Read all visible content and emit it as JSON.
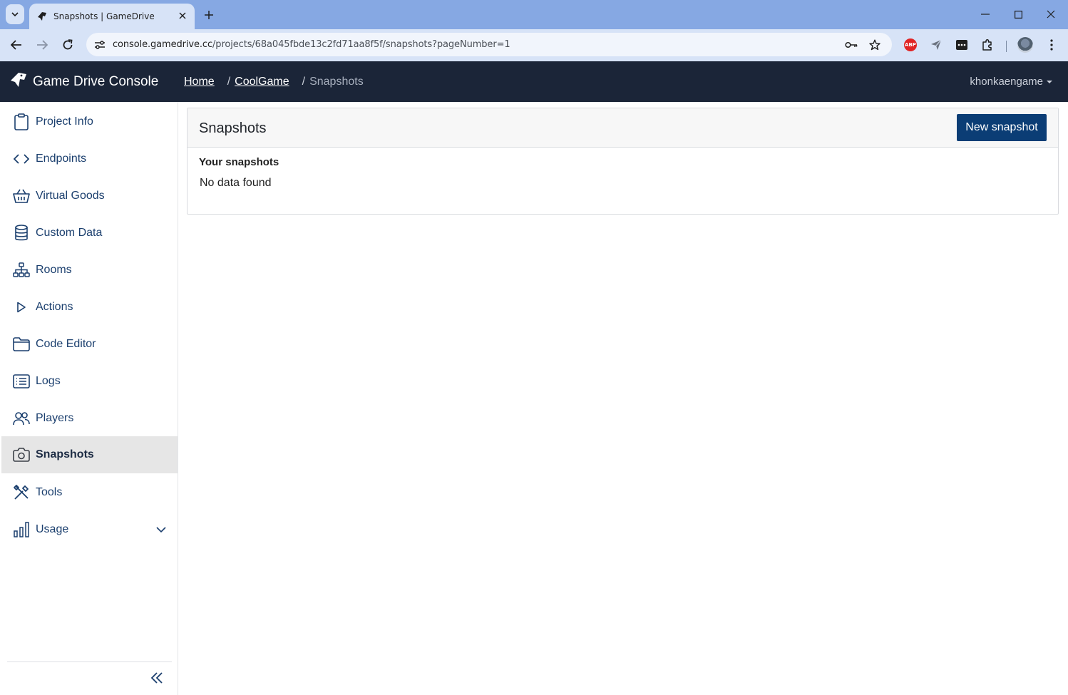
{
  "browser": {
    "tab_title": "Snapshots | GameDrive",
    "url_host": "console.gamedrive.cc",
    "url_path": "/projects/68a045fbde13c2fd71aa8f5f/snapshots?pageNumber=1",
    "extension_abp_label": "ABP"
  },
  "header": {
    "brand": "Game Drive Console",
    "breadcrumbs": [
      {
        "label": "Home"
      },
      {
        "label": "CoolGame"
      },
      {
        "label": "Snapshots"
      }
    ],
    "breadcrumb_separator": "/",
    "user": "khonkaengame"
  },
  "sidebar": {
    "items": [
      {
        "label": "Project Info",
        "icon": "clipboard-icon"
      },
      {
        "label": "Endpoints",
        "icon": "code-icon"
      },
      {
        "label": "Virtual Goods",
        "icon": "basket-icon"
      },
      {
        "label": "Custom Data",
        "icon": "database-icon"
      },
      {
        "label": "Rooms",
        "icon": "network-icon"
      },
      {
        "label": "Actions",
        "icon": "play-icon"
      },
      {
        "label": "Code Editor",
        "icon": "folder-icon"
      },
      {
        "label": "Logs",
        "icon": "list-icon"
      },
      {
        "label": "Players",
        "icon": "users-icon"
      },
      {
        "label": "Snapshots",
        "icon": "camera-icon",
        "active": true
      },
      {
        "label": "Tools",
        "icon": "tools-icon"
      },
      {
        "label": "Usage",
        "icon": "bar-chart-icon",
        "expandable": true
      }
    ]
  },
  "main": {
    "title": "Snapshots",
    "new_button": "New snapshot",
    "section_title": "Your snapshots",
    "empty_text": "No data found"
  },
  "colors": {
    "header_bg": "#1b2538",
    "primary_button": "#0b3d75",
    "sidebar_text": "#1b3f6e",
    "active_item_bg": "#e6e6e6"
  }
}
